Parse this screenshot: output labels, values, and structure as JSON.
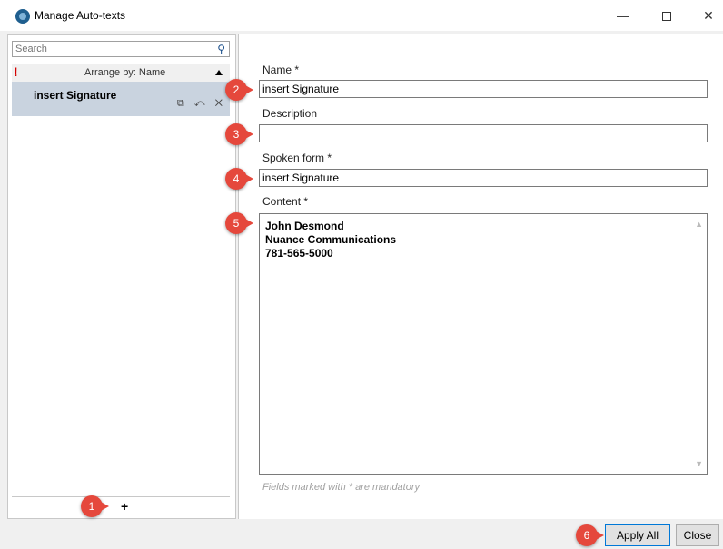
{
  "window": {
    "title": "Manage Auto-texts",
    "minimize": "—",
    "close": "✕"
  },
  "left": {
    "search_placeholder": "Search",
    "search_icon": "⚲",
    "mandatory_indicator": "!",
    "arrange_label": "Arrange by: Name",
    "items": [
      {
        "label": "insert Signature",
        "icons": "⧉ ↶ ✕"
      }
    ],
    "add_label": "+"
  },
  "form": {
    "name_label": "Name *",
    "name_value": "insert Signature",
    "description_label": "Description",
    "description_value": "",
    "spoken_label": "Spoken form *",
    "spoken_value": "insert Signature",
    "content_label": "Content *",
    "content_lines": [
      "John Desmond",
      "Nuance Communications",
      "781-565-5000"
    ],
    "mandatory_note": "Fields marked with * are mandatory"
  },
  "buttons": {
    "apply_all": "Apply All",
    "close": "Close"
  },
  "markers": [
    "1",
    "2",
    "3",
    "4",
    "5",
    "6"
  ],
  "colors": {
    "marker": "#e5483c",
    "selection": "#c9d3df",
    "accent": "#0078d7"
  }
}
